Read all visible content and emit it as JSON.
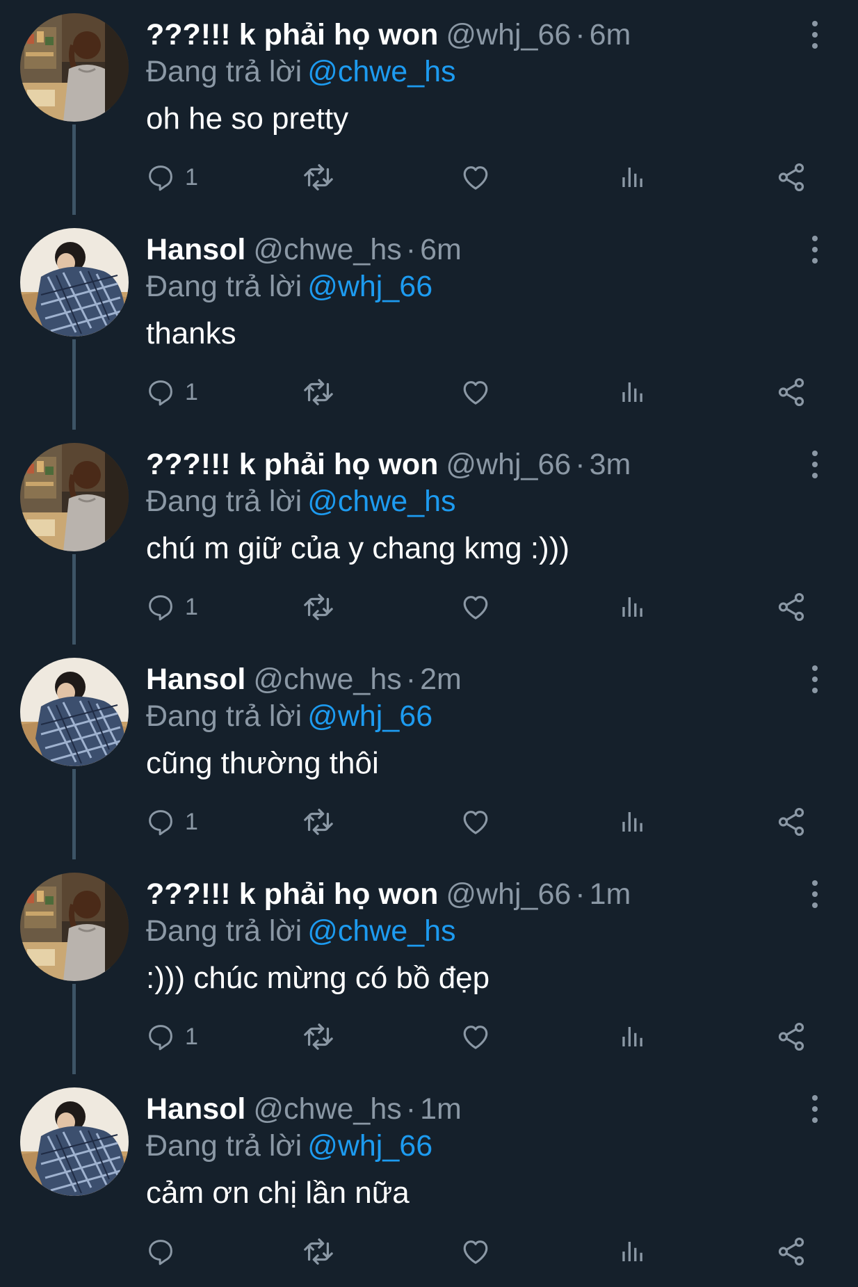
{
  "tweets": [
    {
      "display_name": "???!!! k phải họ won",
      "handle": "@whj_66",
      "time": "6m",
      "replying_prefix": "Đang trả lời",
      "replying_to": "@chwe_hs",
      "text": "oh he so pretty",
      "reply_count": "1",
      "avatar": "girl-avatar"
    },
    {
      "display_name": "Hansol",
      "handle": "@chwe_hs",
      "time": "6m",
      "replying_prefix": "Đang trả lời",
      "replying_to": "@whj_66",
      "text": "thanks",
      "reply_count": "1",
      "avatar": "boy-avatar"
    },
    {
      "display_name": "???!!! k phải họ won",
      "handle": "@whj_66",
      "time": "3m",
      "replying_prefix": "Đang trả lời",
      "replying_to": "@chwe_hs",
      "text": "chú m giữ của y chang kmg :)))",
      "reply_count": "1",
      "avatar": "girl-avatar"
    },
    {
      "display_name": "Hansol",
      "handle": "@chwe_hs",
      "time": "2m",
      "replying_prefix": "Đang trả lời",
      "replying_to": "@whj_66",
      "text": "cũng thường thôi",
      "reply_count": "1",
      "avatar": "boy-avatar"
    },
    {
      "display_name": "???!!! k phải họ won",
      "handle": "@whj_66",
      "time": "1m",
      "replying_prefix": "Đang trả lời",
      "replying_to": "@chwe_hs",
      "text": ":))) chúc mừng có bồ đẹp",
      "reply_count": "1",
      "avatar": "girl-avatar"
    },
    {
      "display_name": "Hansol",
      "handle": "@chwe_hs",
      "time": "1m",
      "replying_prefix": "Đang trả lời",
      "replying_to": "@whj_66",
      "text": "cảm ơn chị lần nữa",
      "reply_count": "",
      "avatar": "boy-avatar"
    }
  ],
  "separator": "·",
  "icons": {
    "reply": "reply-icon",
    "retweet": "retweet-icon",
    "like": "heart-icon",
    "views": "views-icon",
    "share": "share-icon",
    "more": "more-options-icon"
  },
  "colors": {
    "background": "#15202b",
    "text_primary": "#ffffff",
    "text_secondary": "#8b98a5",
    "link": "#1d9bf0",
    "thread_line": "#3d5466"
  }
}
